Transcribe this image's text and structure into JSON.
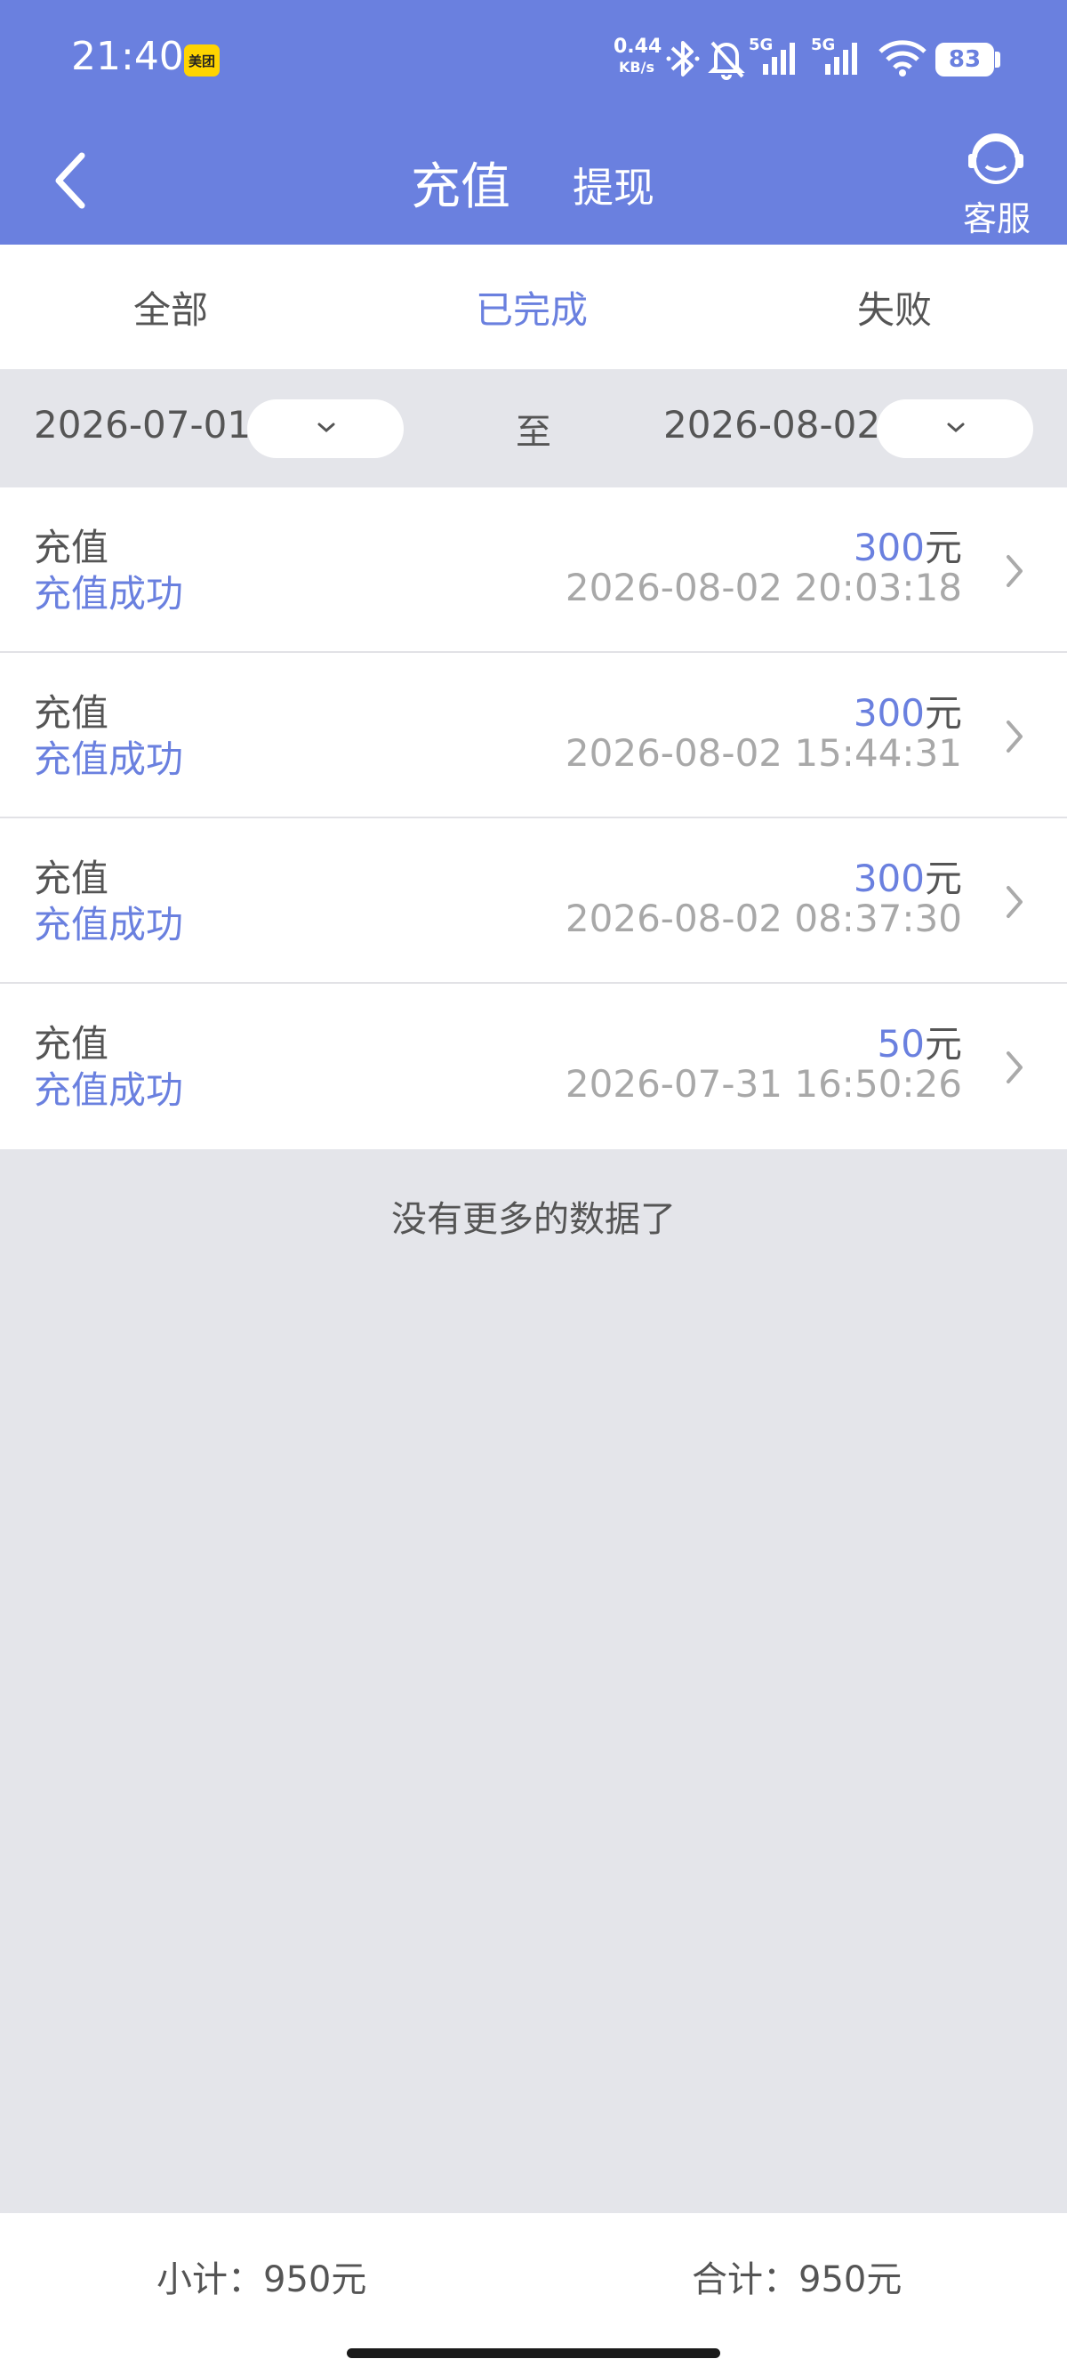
{
  "status_bar": {
    "time": "21:40",
    "app_badge": "美团",
    "net_speed_value": "0.44",
    "net_speed_unit": "KB/s",
    "signal_label_1": "5G",
    "signal_label_2": "5G",
    "battery": "83"
  },
  "nav": {
    "title": "充值",
    "secondary_tab": "提现",
    "customer_service": "客服"
  },
  "tabs": [
    {
      "label": "全部",
      "active": false
    },
    {
      "label": "已完成",
      "active": true
    },
    {
      "label": "失败",
      "active": false
    }
  ],
  "date_filter": {
    "start_date": "2026-07-01",
    "to_label": "至",
    "end_date": "2026-08-02"
  },
  "records": [
    {
      "type": "充值",
      "status": "充值成功",
      "amount": "300",
      "unit": "元",
      "datetime": "2026-08-02 20:03:18"
    },
    {
      "type": "充值",
      "status": "充值成功",
      "amount": "300",
      "unit": "元",
      "datetime": "2026-08-02 15:44:31"
    },
    {
      "type": "充值",
      "status": "充值成功",
      "amount": "300",
      "unit": "元",
      "datetime": "2026-08-02 08:37:30"
    },
    {
      "type": "充值",
      "status": "充值成功",
      "amount": "50",
      "unit": "元",
      "datetime": "2026-07-31 16:50:26"
    }
  ],
  "no_more_text": "没有更多的数据了",
  "footer": {
    "subtotal": "小计：950元",
    "total": "合计：950元"
  },
  "colors": {
    "accent": "#6a80df",
    "background": "#e4e5ea"
  }
}
